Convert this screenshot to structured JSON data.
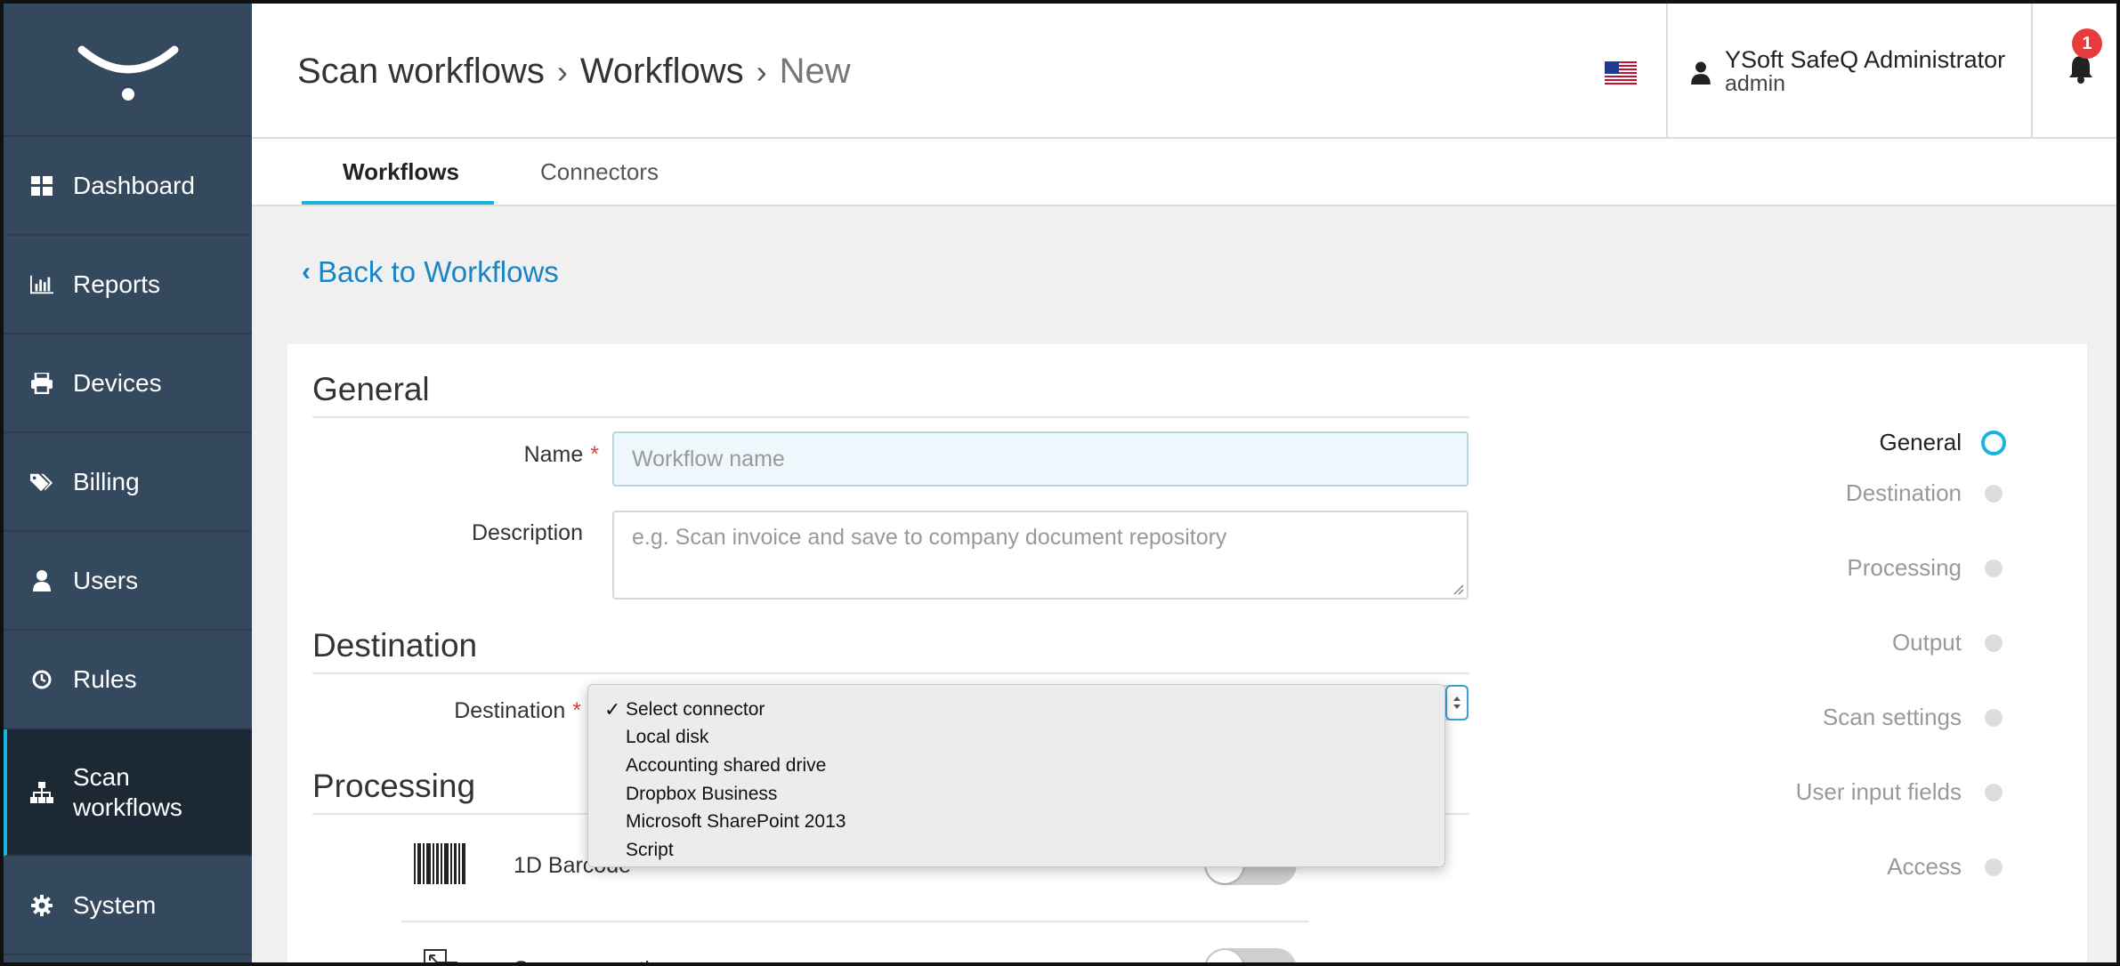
{
  "sidebar": {
    "items": [
      {
        "label": "Dashboard",
        "icon": "dashboard-icon"
      },
      {
        "label": "Reports",
        "icon": "bar-chart-icon"
      },
      {
        "label": "Devices",
        "icon": "printer-icon"
      },
      {
        "label": "Billing",
        "icon": "tags-icon"
      },
      {
        "label": "Users",
        "icon": "user-icon"
      },
      {
        "label": "Rules",
        "icon": "clock-icon"
      },
      {
        "label": "Scan workflows",
        "icon": "sitemap-icon",
        "active": true
      },
      {
        "label": "System",
        "icon": "gear-icon"
      }
    ]
  },
  "header": {
    "breadcrumb": [
      "Scan workflows",
      "Workflows",
      "New"
    ],
    "separator": "›",
    "user_name": "YSoft SafeQ Administrator",
    "user_login": "admin",
    "notification_count": "1"
  },
  "tabs": [
    {
      "label": "Workflows",
      "active": true
    },
    {
      "label": "Connectors",
      "active": false
    }
  ],
  "back_link": "Back to Workflows",
  "form": {
    "general_title": "General",
    "name_label": "Name",
    "name_placeholder": "Workflow name",
    "description_label": "Description",
    "description_placeholder": "e.g. Scan invoice and save to company document repository",
    "destination_title": "Destination",
    "destination_label": "Destination",
    "required_marker": "*",
    "processing_title": "Processing",
    "processing_rows": [
      {
        "label": "1D Barcode",
        "enabled": false
      },
      {
        "label": "Scan separation",
        "enabled": false
      }
    ]
  },
  "dropdown": {
    "selected": "Select connector",
    "options": [
      "Select connector",
      "Local disk",
      "Accounting shared drive",
      "Dropbox Business",
      "Microsoft SharePoint 2013",
      "Script"
    ]
  },
  "steps": [
    {
      "label": "General",
      "active": true
    },
    {
      "label": "Destination",
      "active": false
    },
    {
      "label": "Processing",
      "active": false
    },
    {
      "label": "Output",
      "active": false
    },
    {
      "label": "Scan settings",
      "active": false
    },
    {
      "label": "User input fields",
      "active": false
    },
    {
      "label": "Access",
      "active": false
    }
  ],
  "colors": {
    "sidebar_bg": "#34495e",
    "accent": "#1ab3e0",
    "link": "#1a85c6",
    "required": "#e23b3b"
  }
}
